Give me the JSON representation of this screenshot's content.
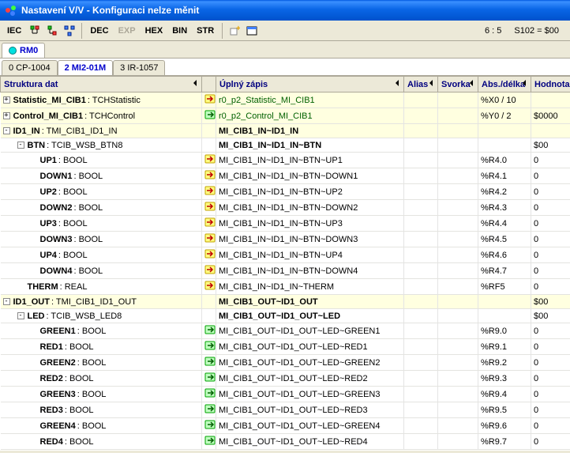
{
  "title": "Nastavení V/V - Konfiguraci nelze měnit",
  "toolbar": {
    "iec": "IEC",
    "dec": "DEC",
    "exp": "EXP",
    "hex": "HEX",
    "bin": "BIN",
    "str": "STR",
    "status_left": "6 : 5",
    "status_right": "S102 = $00"
  },
  "tab1": {
    "label": "RM0"
  },
  "tabs2": [
    {
      "label": "0 CP-1004",
      "active": false
    },
    {
      "label": "2 MI2-01M",
      "active": true
    },
    {
      "label": "3 IR-1057",
      "active": false
    }
  ],
  "headers": {
    "struct": "Struktura dat",
    "zapis": "Úplný zápis",
    "alias": "Alias",
    "svorka": "Svorka",
    "abs": "Abs./délka",
    "hodnota": "Hodnota"
  },
  "rows": [
    {
      "indent": 0,
      "exp": "+",
      "name": "Statistic_MI_CIB1",
      "type": ": TCHStatistic",
      "icon": "in",
      "zapis": "r0_p2_Statistic_MI_CIB1",
      "zcolor": "green",
      "abs": "%X0 / 10",
      "hod": "",
      "hl": true
    },
    {
      "indent": 0,
      "exp": "+",
      "name": "Control_MI_CIB1",
      "type": ": TCHControl",
      "icon": "out",
      "zapis": "r0_p2_Control_MI_CIB1",
      "zcolor": "green",
      "abs": "%Y0 / 2",
      "hod": "$0000",
      "hl": true
    },
    {
      "indent": 0,
      "exp": "-",
      "name": "ID1_IN",
      "type": ": TMI_CIB1_ID1_IN",
      "icon": "",
      "zapis": "MI_CIB1_IN~ID1_IN",
      "bold": true,
      "abs": "",
      "hod": "",
      "hl": true
    },
    {
      "indent": 1,
      "exp": "-",
      "name": "BTN",
      "type": ": TCIB_WSB_BTN8",
      "icon": "",
      "zapis": "MI_CIB1_IN~ID1_IN~BTN",
      "bold": true,
      "abs": "",
      "hod": "$00"
    },
    {
      "indent": 2,
      "exp": "",
      "name": "UP1",
      "type": ": BOOL",
      "icon": "in",
      "zapis": "MI_CIB1_IN~ID1_IN~BTN~UP1",
      "abs": "%R4.0",
      "hod": "0"
    },
    {
      "indent": 2,
      "exp": "",
      "name": "DOWN1",
      "type": ": BOOL",
      "icon": "in",
      "zapis": "MI_CIB1_IN~ID1_IN~BTN~DOWN1",
      "abs": "%R4.1",
      "hod": "0"
    },
    {
      "indent": 2,
      "exp": "",
      "name": "UP2",
      "type": ": BOOL",
      "icon": "in",
      "zapis": "MI_CIB1_IN~ID1_IN~BTN~UP2",
      "abs": "%R4.2",
      "hod": "0"
    },
    {
      "indent": 2,
      "exp": "",
      "name": "DOWN2",
      "type": ": BOOL",
      "icon": "in",
      "zapis": "MI_CIB1_IN~ID1_IN~BTN~DOWN2",
      "abs": "%R4.3",
      "hod": "0"
    },
    {
      "indent": 2,
      "exp": "",
      "name": "UP3",
      "type": ": BOOL",
      "icon": "in",
      "zapis": "MI_CIB1_IN~ID1_IN~BTN~UP3",
      "abs": "%R4.4",
      "hod": "0"
    },
    {
      "indent": 2,
      "exp": "",
      "name": "DOWN3",
      "type": ": BOOL",
      "icon": "in",
      "zapis": "MI_CIB1_IN~ID1_IN~BTN~DOWN3",
      "abs": "%R4.5",
      "hod": "0"
    },
    {
      "indent": 2,
      "exp": "",
      "name": "UP4",
      "type": ": BOOL",
      "icon": "in",
      "zapis": "MI_CIB1_IN~ID1_IN~BTN~UP4",
      "abs": "%R4.6",
      "hod": "0"
    },
    {
      "indent": 2,
      "exp": "",
      "name": "DOWN4",
      "type": ": BOOL",
      "icon": "in",
      "zapis": "MI_CIB1_IN~ID1_IN~BTN~DOWN4",
      "abs": "%R4.7",
      "hod": "0"
    },
    {
      "indent": 1,
      "exp": "",
      "name": "THERM",
      "type": ": REAL",
      "icon": "in",
      "zapis": "MI_CIB1_IN~ID1_IN~THERM",
      "abs": "%RF5",
      "hod": "0"
    },
    {
      "indent": 0,
      "exp": "-",
      "name": "ID1_OUT",
      "type": ": TMI_CIB1_ID1_OUT",
      "icon": "",
      "zapis": "MI_CIB1_OUT~ID1_OUT",
      "bold": true,
      "abs": "",
      "hod": "$00",
      "hl": true
    },
    {
      "indent": 1,
      "exp": "-",
      "name": "LED",
      "type": ": TCIB_WSB_LED8",
      "icon": "",
      "zapis": "MI_CIB1_OUT~ID1_OUT~LED",
      "bold": true,
      "abs": "",
      "hod": "$00"
    },
    {
      "indent": 2,
      "exp": "",
      "name": "GREEN1",
      "type": ": BOOL",
      "icon": "out",
      "zapis": "MI_CIB1_OUT~ID1_OUT~LED~GREEN1",
      "abs": "%R9.0",
      "hod": "0"
    },
    {
      "indent": 2,
      "exp": "",
      "name": "RED1",
      "type": ": BOOL",
      "icon": "out",
      "zapis": "MI_CIB1_OUT~ID1_OUT~LED~RED1",
      "abs": "%R9.1",
      "hod": "0"
    },
    {
      "indent": 2,
      "exp": "",
      "name": "GREEN2",
      "type": ": BOOL",
      "icon": "out",
      "zapis": "MI_CIB1_OUT~ID1_OUT~LED~GREEN2",
      "abs": "%R9.2",
      "hod": "0"
    },
    {
      "indent": 2,
      "exp": "",
      "name": "RED2",
      "type": ": BOOL",
      "icon": "out",
      "zapis": "MI_CIB1_OUT~ID1_OUT~LED~RED2",
      "abs": "%R9.3",
      "hod": "0"
    },
    {
      "indent": 2,
      "exp": "",
      "name": "GREEN3",
      "type": ": BOOL",
      "icon": "out",
      "zapis": "MI_CIB1_OUT~ID1_OUT~LED~GREEN3",
      "abs": "%R9.4",
      "hod": "0"
    },
    {
      "indent": 2,
      "exp": "",
      "name": "RED3",
      "type": ": BOOL",
      "icon": "out",
      "zapis": "MI_CIB1_OUT~ID1_OUT~LED~RED3",
      "abs": "%R9.5",
      "hod": "0"
    },
    {
      "indent": 2,
      "exp": "",
      "name": "GREEN4",
      "type": ": BOOL",
      "icon": "out",
      "zapis": "MI_CIB1_OUT~ID1_OUT~LED~GREEN4",
      "abs": "%R9.6",
      "hod": "0"
    },
    {
      "indent": 2,
      "exp": "",
      "name": "RED4",
      "type": ": BOOL",
      "icon": "out",
      "zapis": "MI_CIB1_OUT~ID1_OUT~LED~RED4",
      "abs": "%R9.7",
      "hod": "0"
    }
  ]
}
